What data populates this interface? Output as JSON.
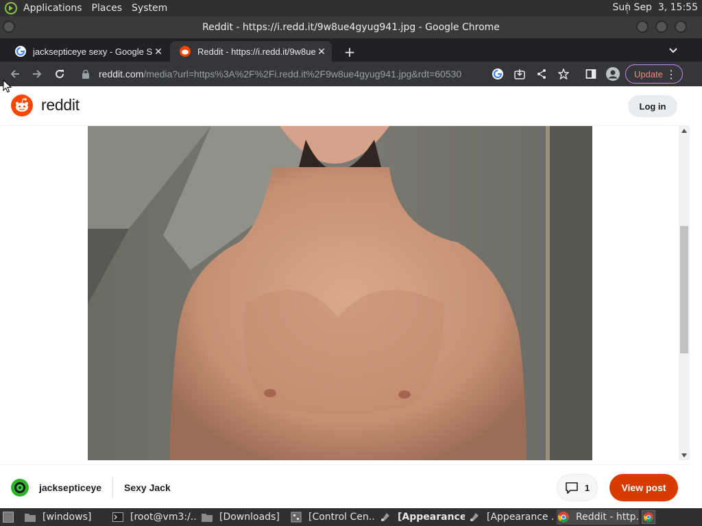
{
  "top_panel": {
    "menus": [
      "Applications",
      "Places",
      "System"
    ],
    "clock": "Sun Sep  3, 15:55"
  },
  "window": {
    "title": "Reddit - https://i.redd.it/9w8ue4gyug941.jpg - Google Chrome"
  },
  "tabs": [
    {
      "label": "jacksepticeye sexy - Google Se",
      "favicon": "google-icon"
    },
    {
      "label": "Reddit - https://i.redd.it/9w8ue",
      "favicon": "reddit-icon"
    }
  ],
  "toolbar": {
    "url_host": "reddit.com",
    "url_path": "/media?url=https%3A%2F%2Fi.redd.it%2F9w8ue4gyug941.jpg&rdt=60530",
    "update_label": "Update"
  },
  "reddit": {
    "wordmark": "reddit",
    "login_label": "Log in",
    "brand_color": "#ff4500"
  },
  "post": {
    "username": "jacksepticeye",
    "title": "Sexy Jack",
    "comment_count": "1",
    "view_post_label": "View post",
    "view_post_color": "#d93a00"
  },
  "taskbar": {
    "items": [
      {
        "label": "[windows]",
        "icon": "folder-icon"
      },
      {
        "label": "[root@vm3:/...",
        "icon": "terminal-icon"
      },
      {
        "label": "[Downloads]",
        "icon": "folder-icon"
      },
      {
        "label": "[Control Cen...",
        "icon": "control-center-icon"
      },
      {
        "label": "[Appearance ...",
        "icon": "appearance-icon"
      },
      {
        "label": "[Appearance ...",
        "icon": "appearance-icon"
      },
      {
        "label": "Reddit - http...",
        "icon": "chrome-icon"
      }
    ]
  }
}
